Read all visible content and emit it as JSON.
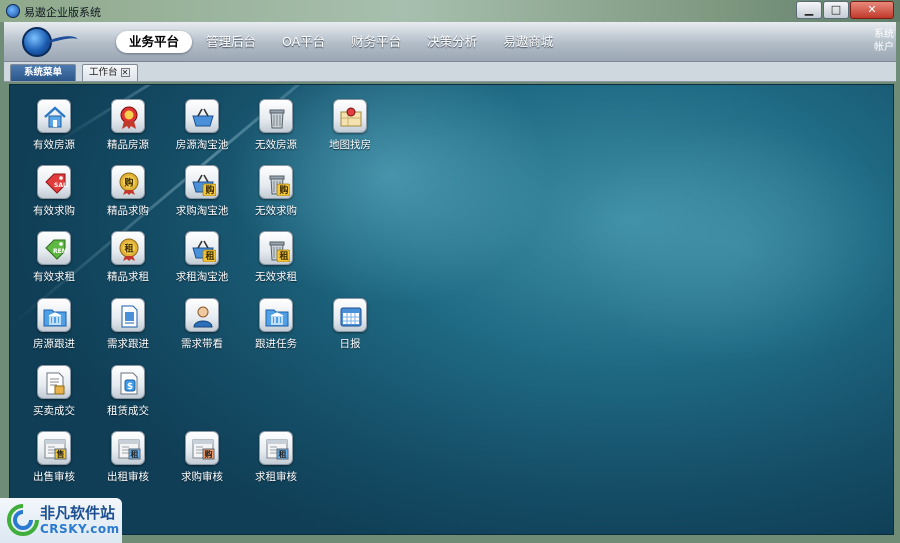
{
  "window": {
    "title": "易遨企业版系统",
    "buttons": {
      "minimize": "▁",
      "maximize": "□",
      "close": "✕"
    }
  },
  "navbar": {
    "items": [
      {
        "label": "业务平台",
        "active": true
      },
      {
        "label": "管理后台",
        "active": false
      },
      {
        "label": "OA平台",
        "active": false
      },
      {
        "label": "财务平台",
        "active": false
      },
      {
        "label": "决策分析",
        "active": false
      },
      {
        "label": "易遨商城",
        "active": false
      }
    ],
    "right_line1": "系统",
    "right_line2": "帐户"
  },
  "tabs": {
    "menu": "系统菜单",
    "work": "工作台",
    "work_close": "✕"
  },
  "icons": [
    {
      "label": "有效房源",
      "icon": "house-icon"
    },
    {
      "label": "精品房源",
      "icon": "premium-badge-icon"
    },
    {
      "label": "房源淘宝池",
      "icon": "basket-icon"
    },
    {
      "label": "无效房源",
      "icon": "trash-icon"
    },
    {
      "label": "地图找房",
      "icon": "map-pin-icon"
    },
    {
      "label": "有效求购",
      "icon": "sale-tag-icon"
    },
    {
      "label": "精品求购",
      "icon": "buy-medal-icon",
      "glyph": "购"
    },
    {
      "label": "求购淘宝池",
      "icon": "buy-basket-icon",
      "glyph": "购"
    },
    {
      "label": "无效求购",
      "icon": "buy-trash-icon",
      "glyph": "购"
    },
    {
      "label": "有效求租",
      "icon": "rent-tag-icon"
    },
    {
      "label": "精品求租",
      "icon": "rent-medal-icon",
      "glyph": "租"
    },
    {
      "label": "求租淘宝池",
      "icon": "rent-basket-icon",
      "glyph": "租"
    },
    {
      "label": "无效求租",
      "icon": "rent-trash-icon",
      "glyph": "租"
    },
    {
      "label": "房源跟进",
      "icon": "bank-folder-icon"
    },
    {
      "label": "需求跟进",
      "icon": "document-icon"
    },
    {
      "label": "需求带看",
      "icon": "person-icon"
    },
    {
      "label": "跟进任务",
      "icon": "task-folder-icon"
    },
    {
      "label": "日报",
      "icon": "calendar-icon"
    },
    {
      "label": "买卖成交",
      "icon": "deal-document-icon"
    },
    {
      "label": "租赁成交",
      "icon": "lease-document-icon",
      "glyph": "$"
    },
    {
      "label": "出售审核",
      "icon": "sale-review-icon",
      "glyph": "售"
    },
    {
      "label": "出租审核",
      "icon": "rent-review-icon",
      "glyph": "租"
    },
    {
      "label": "求购审核",
      "icon": "buy-review-icon",
      "glyph": "购"
    },
    {
      "label": "求租审核",
      "icon": "lease-review-icon",
      "glyph": "租"
    }
  ],
  "watermark": {
    "title": "非凡软件站",
    "subtitle": "CRSKY.com"
  },
  "colors": {
    "accent": "#1d4f91",
    "workspace": "#1f6a84"
  }
}
